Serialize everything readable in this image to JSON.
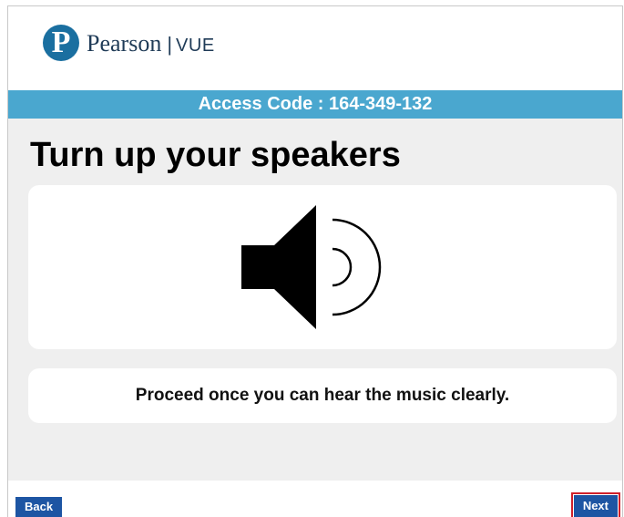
{
  "header": {
    "brand_name": "Pearson",
    "separator": "|",
    "product_name": "VUE",
    "logo_letter": "P"
  },
  "access_code_bar": {
    "text": "Access Code : 164-349-132"
  },
  "main": {
    "title": "Turn up your speakers",
    "speaker_icon": "speaker-volume-icon",
    "message": "Proceed once you can hear the music clearly."
  },
  "footer": {
    "back_label": "Back",
    "next_label": "Next"
  },
  "colors": {
    "brand_blue": "#1a6fa0",
    "code_bar": "#4aa7cf",
    "content_bg": "#efefef",
    "button_bg": "#1d55a3",
    "focus_outline": "#d0202a"
  }
}
